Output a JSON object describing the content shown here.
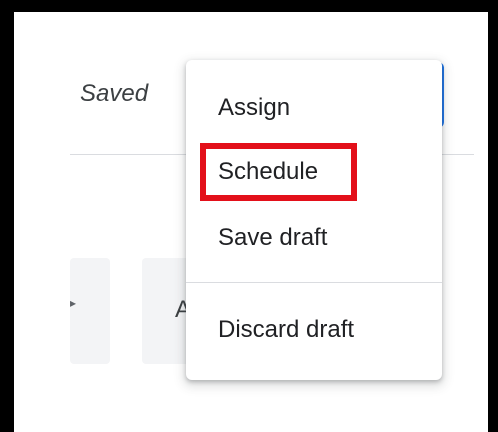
{
  "header": {
    "status_text": "Saved"
  },
  "toolbar": {
    "left_caret": "▸",
    "right_partial_label": "A"
  },
  "menu": {
    "items": [
      {
        "label": "Assign"
      },
      {
        "label": "Schedule"
      },
      {
        "label": "Save draft"
      },
      {
        "label": "Discard draft"
      }
    ]
  },
  "colors": {
    "highlight": "#e3101a",
    "accent": "#1a73e8",
    "divider": "#dadce0"
  }
}
